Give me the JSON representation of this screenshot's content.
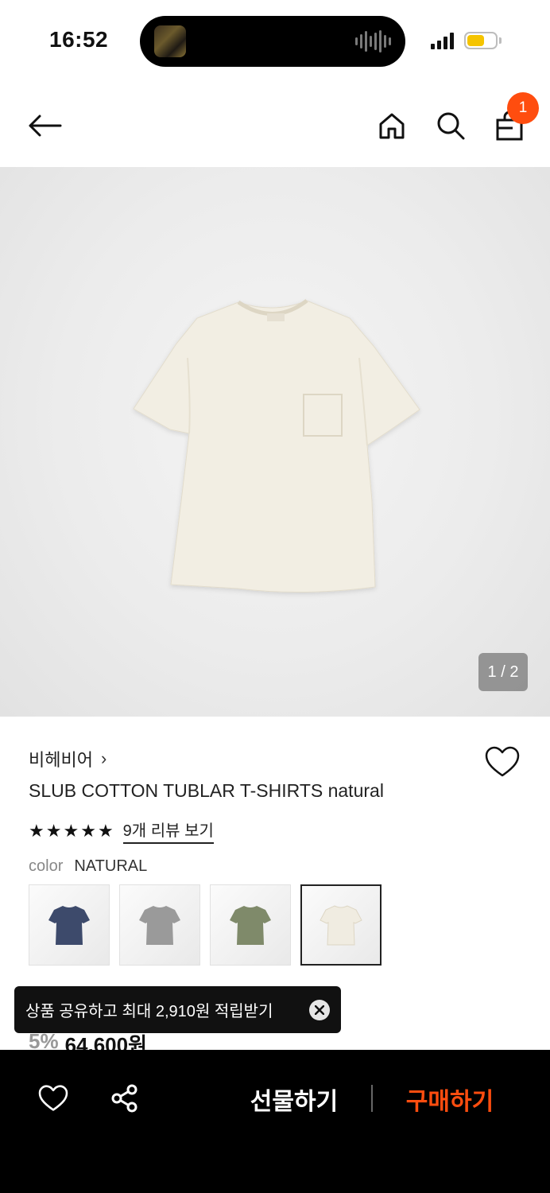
{
  "status_bar": {
    "time": "16:52"
  },
  "header": {
    "cart_count": "1"
  },
  "gallery": {
    "page_indicator": "1 / 2"
  },
  "product": {
    "brand": "비헤비어",
    "brand_chevron": "›",
    "title": "SLUB COTTON TUBLAR T-SHIRTS natural",
    "rating_stars": 5,
    "review_link": "9개 리뷰 보기",
    "color_label": "color",
    "color_value": "NATURAL",
    "swatches": [
      {
        "name": "navy",
        "color": "#3d4a6b"
      },
      {
        "name": "gray",
        "color": "#9a9a9a"
      },
      {
        "name": "olive",
        "color": "#7f8a6a"
      },
      {
        "name": "natural",
        "color": "#f0ece1",
        "selected": true
      }
    ],
    "discount": "5%",
    "price": "64,600원"
  },
  "toast": {
    "text": "상품 공유하고 최대 2,910원 적립받기"
  },
  "bottom_bar": {
    "gift_label": "선물하기",
    "buy_label": "구매하기"
  },
  "colors": {
    "accent": "#ff4d0f",
    "bottom_bar_bg": "#000000",
    "battery": "#f5c400"
  }
}
